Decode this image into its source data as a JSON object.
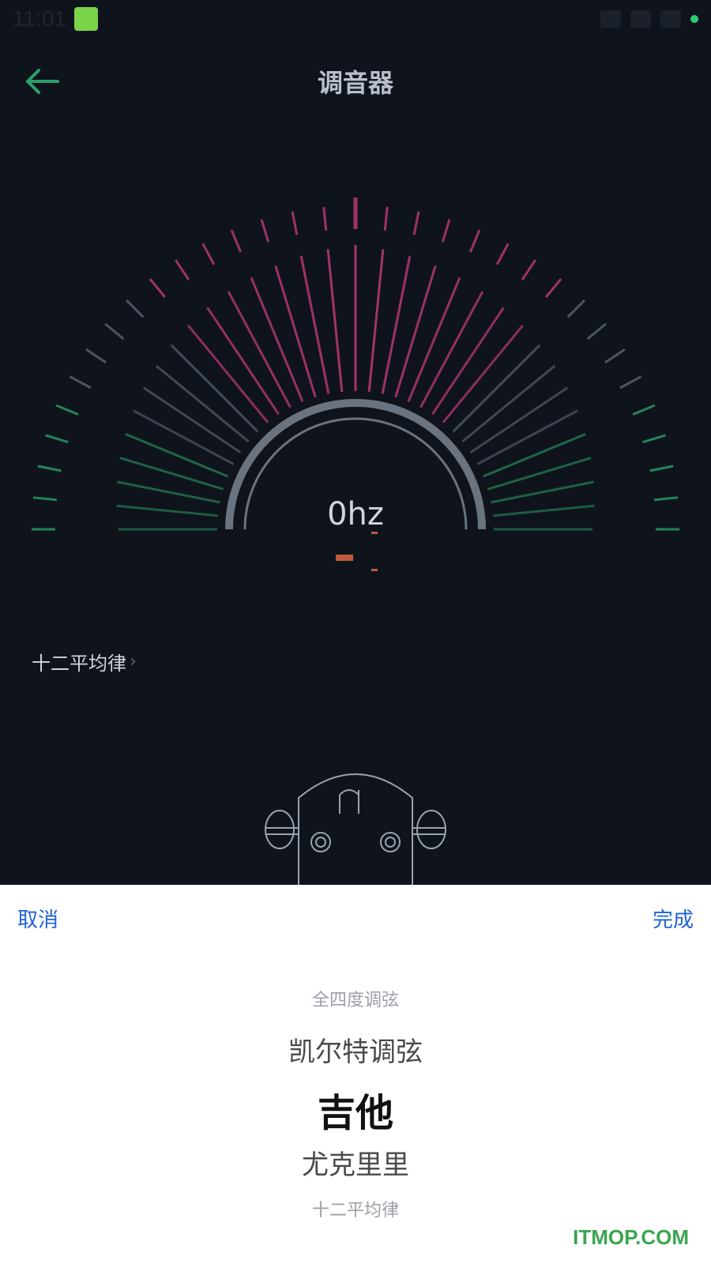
{
  "status": {
    "time": "11:01"
  },
  "topbar": {
    "title": "调音器"
  },
  "meter": {
    "hz": "0hz"
  },
  "temperament": {
    "label": "十二平均律"
  },
  "sheet": {
    "cancel": "取消",
    "done": "完成",
    "options": [
      "全四度调弦",
      "凯尔特调弦",
      "吉他",
      "尤克里里",
      "十二平均律"
    ]
  },
  "watermark": "ITMOP.COM",
  "colors": {
    "accent": "#1e63d6",
    "pink": "#c23a7a",
    "green": "#2aa06a",
    "bg": "#0f141c"
  }
}
